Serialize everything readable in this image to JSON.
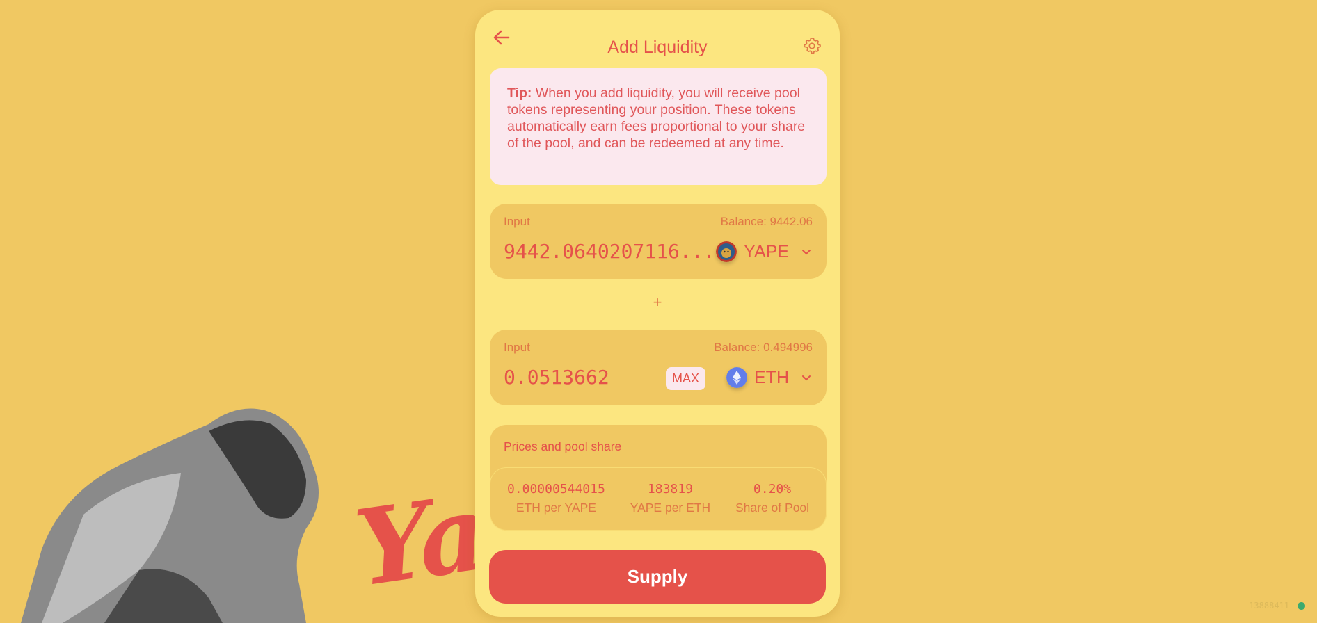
{
  "header": {
    "title": "Add Liquidity",
    "back_icon": "arrow-left-icon",
    "settings_icon": "gear-icon"
  },
  "tip": {
    "label": "Tip:",
    "text": " When you add liquidity, you will receive pool tokens representing your position. These tokens automatically earn fees proportional to your share of the pool, and can be redeemed at any time."
  },
  "input_a": {
    "label": "Input",
    "balance": "Balance: 9442.06",
    "amount": "9442.0640207116...",
    "token": "YAPE"
  },
  "plus": "+",
  "input_b": {
    "label": "Input",
    "balance": "Balance: 0.494996",
    "amount": "0.0513662",
    "max": "MAX",
    "token": "ETH"
  },
  "prices": {
    "title": "Prices and pool share",
    "stats": [
      {
        "value": "0.00000544015",
        "label": "ETH per YAPE"
      },
      {
        "value": "183819",
        "label": "YAPE per ETH"
      },
      {
        "value": "0.20%",
        "label": "Share of Pool"
      }
    ]
  },
  "supply_label": "Supply",
  "block_number": "13888411",
  "background_logo_text": "Ya",
  "colors": {
    "accent": "#e5524a",
    "background": "#f0c862",
    "card": "#fce680",
    "tip": "#fbe8ee",
    "status": "#3daa6e"
  }
}
